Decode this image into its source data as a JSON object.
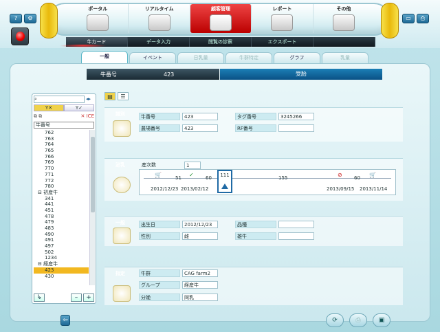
{
  "topnav": {
    "modules": [
      {
        "label": "ポータル",
        "icon": "portal-icon"
      },
      {
        "label": "リアルタイム",
        "icon": "realtime-icon"
      },
      {
        "label": "顧客管理",
        "icon": "customer-icon",
        "active": true
      },
      {
        "label": "レポート",
        "icon": "report-icon"
      },
      {
        "label": "その他",
        "icon": "other-icon"
      }
    ],
    "subitems": [
      "牛カード",
      "データ入力",
      "閲覧の診察",
      "エクスポート",
      ""
    ]
  },
  "tabs": [
    {
      "label": "一般",
      "active": true
    },
    {
      "label": "イベント"
    },
    {
      "label": "日乳量",
      "disabled": true
    },
    {
      "label": "牛群特定",
      "disabled": true
    },
    {
      "label": "グラフ"
    },
    {
      "label": "乳量",
      "disabled": true
    }
  ],
  "header": {
    "cow_no_label": "牛番号",
    "cow_no": "423",
    "status": "受胎"
  },
  "tree": {
    "search_value": "",
    "filter_labels": [
      "Y✕",
      "Y✓"
    ],
    "tools": "✕ ICE",
    "dropdown": "牛番号",
    "items": [
      "762",
      "763",
      "764",
      "765",
      "766",
      "769",
      "770",
      "771",
      "772",
      "780",
      "⊟ 初産牛",
      "341",
      "441",
      "451",
      "478",
      "479",
      "483",
      "490",
      "491",
      "497",
      "502",
      "1234",
      "⊟ 経産牛",
      "423",
      "430"
    ],
    "selected": "423",
    "footer": [
      "↳",
      "–",
      "+"
    ]
  },
  "sections": {
    "ident": {
      "tag": "識別",
      "fields": [
        {
          "label": "牛番号",
          "value": "423"
        },
        {
          "label": "農場番号",
          "value": "423"
        },
        {
          "label": "タグ番号",
          "value": "3245266"
        },
        {
          "label": "RF番号",
          "value": ""
        }
      ]
    },
    "lact": {
      "tag": "泌乳",
      "label": "産次数",
      "value": "1",
      "timeline": {
        "marker": "111",
        "gaps": [
          "51",
          "60",
          "155",
          "60"
        ],
        "dates": [
          "2012/12/23",
          "2013/02/12",
          "2013/09/15",
          "2013/11/14"
        ]
      }
    },
    "general": {
      "tag": "一般",
      "fields": [
        {
          "label": "出生日",
          "value": "2012/12/23"
        },
        {
          "label": "性別",
          "value": "雌"
        },
        {
          "label": "品種",
          "value": ""
        },
        {
          "label": "雄牛",
          "value": ""
        }
      ]
    },
    "assign": {
      "tag": "指定",
      "fields": [
        {
          "label": "牛群",
          "value": "CAG farm2"
        },
        {
          "label": "グループ",
          "value": "経産牛"
        },
        {
          "label": "分娩",
          "value": "同乳"
        }
      ]
    }
  },
  "colors": {
    "accent": "#1c7fb6",
    "active_module": "#cc1111",
    "selection": "#f2b820"
  }
}
